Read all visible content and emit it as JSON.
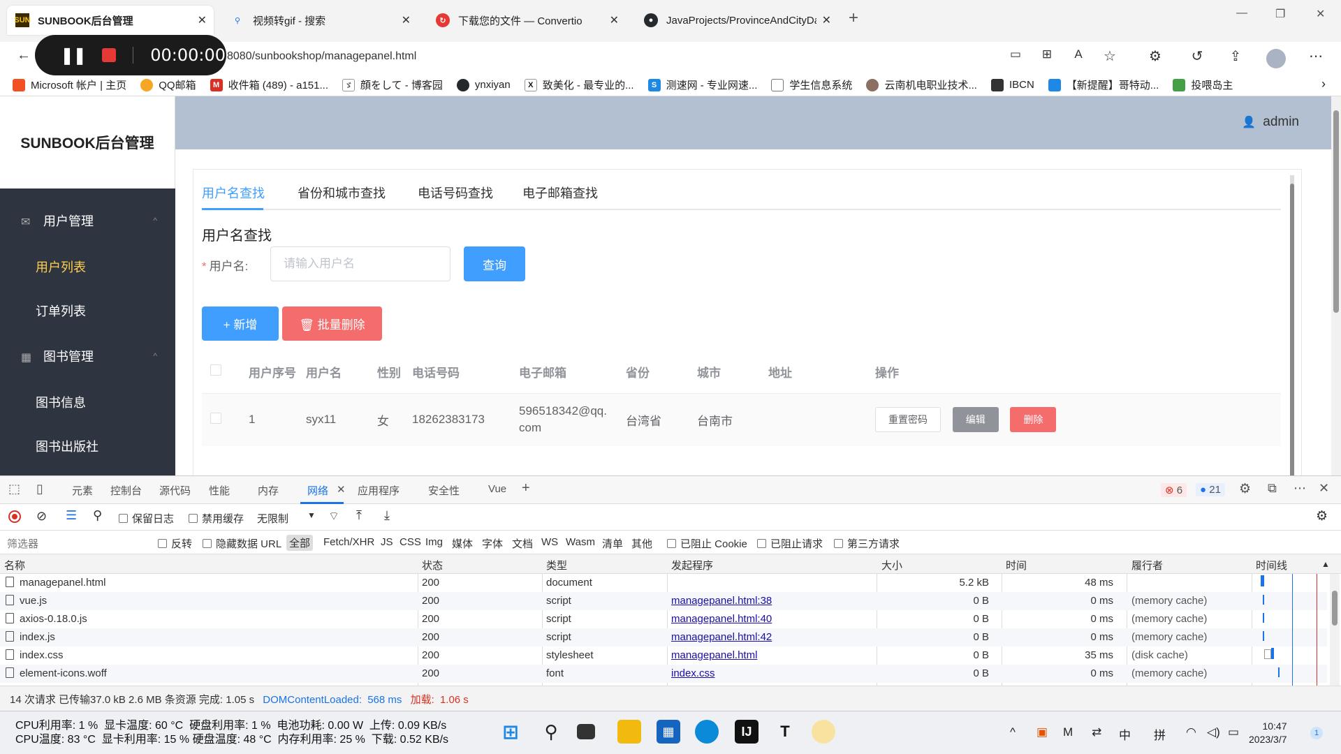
{
  "browser": {
    "tabs": [
      {
        "title": "SUNBOOK后台管理",
        "icon": "SUN",
        "active": true
      },
      {
        "title": "视频转gif - 搜索",
        "icon": "search-icon"
      },
      {
        "title": "下载您的文件 — Convertio",
        "icon": "convertio-icon"
      },
      {
        "title": "JavaProjects/ProvinceAndCityDa",
        "icon": "github-icon"
      }
    ],
    "new_tab": "+",
    "url": "8080/sunbookshop/managepanel.html",
    "recorder_time": "00:00:00",
    "bookmarks": [
      {
        "label": "Microsoft 帐户 | 主页",
        "color": "#f25022"
      },
      {
        "label": "QQ邮箱",
        "color": "#f5a623"
      },
      {
        "label": "收件箱 (489) - a151...",
        "color": "#d93025"
      },
      {
        "label": "顔をして - 博客园",
        "color": "#555555"
      },
      {
        "label": "ynxiyan",
        "color": "#24292e"
      },
      {
        "label": "致美化 - 最专业的...",
        "color": "#111111"
      },
      {
        "label": "测速网 - 专业网速...",
        "color": "#1e88e5"
      },
      {
        "label": "学生信息系统",
        "color": "#777777"
      },
      {
        "label": "云南机电职业技术...",
        "color": "#8d6e63"
      },
      {
        "label": "IBCN",
        "color": "#333333"
      },
      {
        "label": "【新提醒】哥特动...",
        "color": "#1e88e5"
      },
      {
        "label": "投喂岛主",
        "color": "#43a047"
      }
    ]
  },
  "app": {
    "brand": "SUNBOOK后台管理",
    "user": "admin",
    "menu": {
      "group1": "用户管理",
      "group1_items": [
        "用户列表",
        "订单列表"
      ],
      "group2": "图书管理",
      "group2_items": [
        "图书信息",
        "图书出版社"
      ]
    },
    "search_tabs": [
      "用户名查找",
      "省份和城市查找",
      "电话号码查找",
      "电子邮箱查找"
    ],
    "form_title": "用户名查找",
    "form_label": "用户名:",
    "form_placeholder": "请输入用户名",
    "query_button": "查询",
    "add_button": "+ 新增",
    "batch_delete_button": "批量删除",
    "table": {
      "columns": [
        "用户序号",
        "用户名",
        "性别",
        "电话号码",
        "电子邮箱",
        "省份",
        "城市",
        "地址",
        "操作"
      ],
      "rows": [
        {
          "id": "1",
          "username": "syx11",
          "gender": "女",
          "phone": "18262383173",
          "email": "596518342@qq.com",
          "province": "台湾省",
          "city": "台南市",
          "address": ""
        }
      ],
      "actions": [
        "重置密码",
        "编辑",
        "删除"
      ]
    }
  },
  "devtools": {
    "tabs": [
      "元素",
      "控制台",
      "源代码",
      "性能",
      "内存",
      "网络",
      "应用程序",
      "安全性",
      "Vue"
    ],
    "errors": "6",
    "messages": "21",
    "toolbar": {
      "preserve_log": "保留日志",
      "disable_cache": "禁用缓存",
      "throttle": "无限制"
    },
    "filter": {
      "placeholder": "筛选器",
      "invert": "反转",
      "hide_data_url": "隐藏数据 URL",
      "types": [
        "全部",
        "Fetch/XHR",
        "JS",
        "CSS",
        "Img",
        "媒体",
        "字体",
        "文档",
        "WS",
        "Wasm",
        "清单",
        "其他"
      ],
      "blocked_cookies": "已阻止 Cookie",
      "blocked_requests": "已阻止请求",
      "third_party": "第三方请求"
    },
    "columns": [
      "名称",
      "状态",
      "类型",
      "发起程序",
      "大小",
      "时间",
      "履行者",
      "时间线"
    ],
    "requests": [
      {
        "name": "managepanel.html",
        "status": "200",
        "type": "document",
        "initiator": "",
        "size": "5.2 kB",
        "time": "48 ms",
        "fulfilled": ""
      },
      {
        "name": "vue.js",
        "status": "200",
        "type": "script",
        "initiator": "managepanel.html:38",
        "size": "0 B",
        "time": "0 ms",
        "fulfilled": "(memory cache)"
      },
      {
        "name": "axios-0.18.0.js",
        "status": "200",
        "type": "script",
        "initiator": "managepanel.html:40",
        "size": "0 B",
        "time": "0 ms",
        "fulfilled": "(memory cache)"
      },
      {
        "name": "index.js",
        "status": "200",
        "type": "script",
        "initiator": "managepanel.html:42",
        "size": "0 B",
        "time": "0 ms",
        "fulfilled": "(memory cache)"
      },
      {
        "name": "index.css",
        "status": "200",
        "type": "stylesheet",
        "initiator": "managepanel.html",
        "size": "0 B",
        "time": "35 ms",
        "fulfilled": "(disk cache)"
      },
      {
        "name": "element-icons.woff",
        "status": "200",
        "type": "font",
        "initiator": "index.css",
        "size": "0 B",
        "time": "0 ms",
        "fulfilled": "(memory cache)"
      }
    ],
    "status": {
      "summary": "14 次请求  已传输37.0 kB  2.6 MB 条资源  完成: 1.05 s",
      "dcl_label": "DOMContentLoaded:",
      "dcl_value": "568 ms",
      "load_label": "加载:",
      "load_value": "1.06 s"
    }
  },
  "taskbar": {
    "sysinfo_line1": "CPU利用率: 1 %  显卡温度: 60 °C  硬盘利用率: 1 %  电池功耗: 0.00 W  上传: 0.09 KB/s",
    "sysinfo_line2": "CPU温度: 83 °C  显卡利用率: 15 % 硬盘温度: 48 °C  内存利用率: 25 %  下载: 0.52 KB/s",
    "ime_lang": "中",
    "ime_mode": "拼",
    "time": "10:47",
    "date": "2023/3/7"
  }
}
